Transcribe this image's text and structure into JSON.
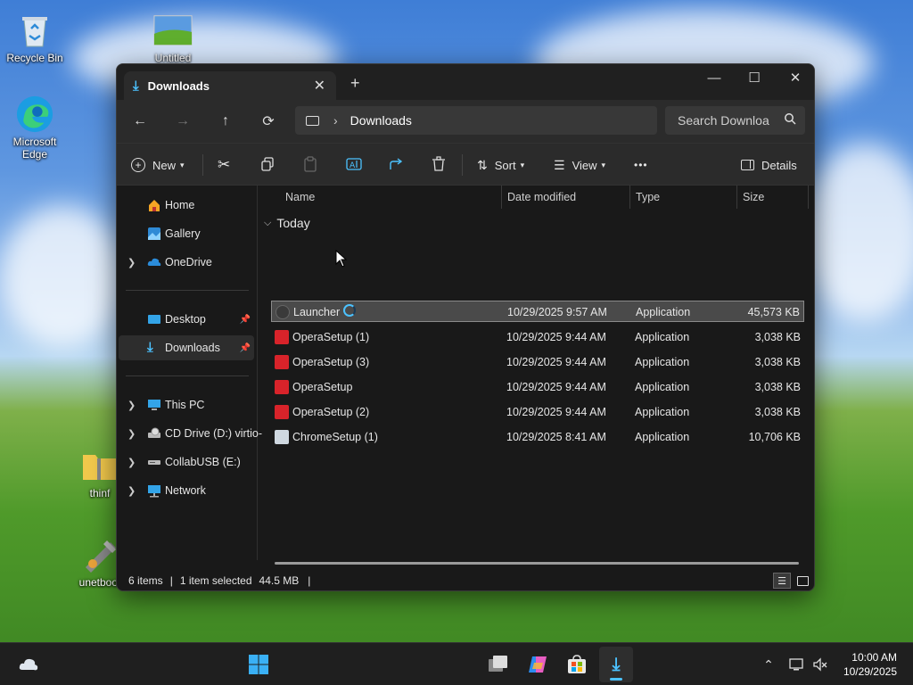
{
  "desktop": {
    "icons": [
      {
        "label": "Recycle Bin"
      },
      {
        "label": "Untitled"
      },
      {
        "label": "Microsoft Edge"
      },
      {
        "label": "thinf"
      },
      {
        "label": "unetboot"
      }
    ]
  },
  "window": {
    "tab_title": "Downloads",
    "new_tab": "+",
    "tab_close": "✕",
    "controls": {
      "minimize": "—",
      "maximize": "☐",
      "close": "✕"
    },
    "nav": {
      "back": "←",
      "forward": "→",
      "up": "↑",
      "refresh": "⟳"
    },
    "address": {
      "separator": "›",
      "location": "Downloads"
    },
    "search": {
      "placeholder": "Search Downloa"
    },
    "toolbar": {
      "new_label": "New",
      "sort_label": "Sort",
      "view_label": "View",
      "more_label": "•••",
      "details_label": "Details"
    },
    "sidebar": {
      "items": [
        {
          "label": "Home"
        },
        {
          "label": "Gallery"
        },
        {
          "label": "OneDrive"
        },
        {
          "label": "Desktop"
        },
        {
          "label": "Downloads"
        },
        {
          "label": "This PC"
        },
        {
          "label": "CD Drive (D:) virtio-"
        },
        {
          "label": "CollabUSB (E:)"
        },
        {
          "label": "Network"
        }
      ]
    },
    "columns": {
      "name": "Name",
      "date": "Date modified",
      "type": "Type",
      "size": "Size"
    },
    "group_label": "Today",
    "files": [
      {
        "name": "Launcher",
        "date": "10/29/2025 9:57 AM",
        "type": "Application",
        "size": "45,573 KB"
      },
      {
        "name": "OperaSetup (1)",
        "date": "10/29/2025 9:44 AM",
        "type": "Application",
        "size": "3,038 KB"
      },
      {
        "name": "OperaSetup (3)",
        "date": "10/29/2025 9:44 AM",
        "type": "Application",
        "size": "3,038 KB"
      },
      {
        "name": "OperaSetup",
        "date": "10/29/2025 9:44 AM",
        "type": "Application",
        "size": "3,038 KB"
      },
      {
        "name": "OperaSetup (2)",
        "date": "10/29/2025 9:44 AM",
        "type": "Application",
        "size": "3,038 KB"
      },
      {
        "name": "ChromeSetup (1)",
        "date": "10/29/2025 8:41 AM",
        "type": "Application",
        "size": "10,706 KB"
      }
    ],
    "status": {
      "items": "6 items",
      "selected": "1 item selected",
      "size": "44.5 MB"
    }
  },
  "taskbar": {
    "time": "10:00 AM",
    "date": "10/29/2025"
  },
  "colors": {
    "window_bg": "#191919",
    "bar_bg": "#2b2b2b",
    "accent": "#4cc2ff",
    "opera_red": "#d8232a"
  }
}
